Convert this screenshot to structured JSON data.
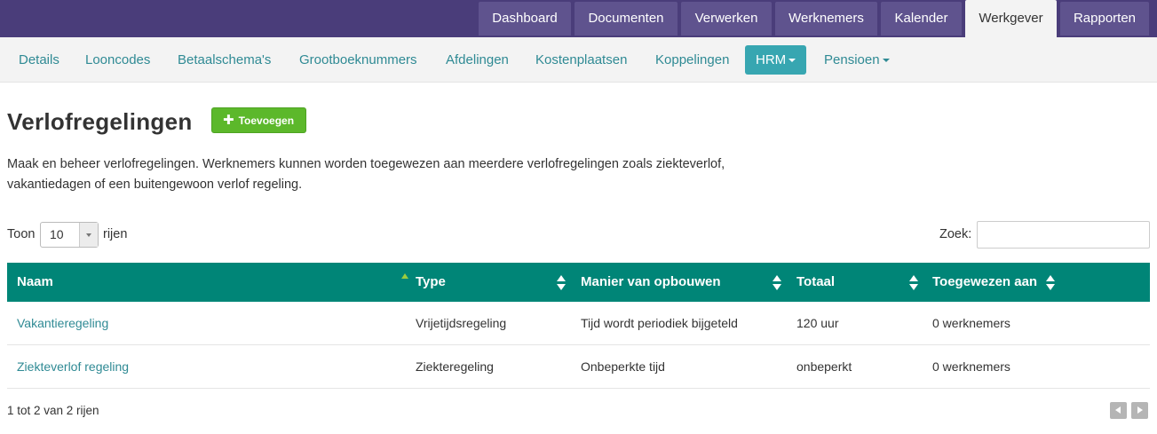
{
  "top_nav": [
    "Dashboard",
    "Documenten",
    "Verwerken",
    "Werknemers",
    "Kalender",
    "Werkgever",
    "Rapporten"
  ],
  "top_nav_active": "Werkgever",
  "sub_nav": [
    "Details",
    "Looncodes",
    "Betaalschema's",
    "Grootboeknummers",
    "Afdelingen",
    "Kostenplaatsen",
    "Koppelingen",
    "HRM",
    "Pensioen"
  ],
  "sub_nav_active": "HRM",
  "page": {
    "title": "Verlofregelingen",
    "add_button": "Toevoegen",
    "description": "Maak en beheer verlofregelingen. Werknemers kunnen worden toegewezen aan meerdere verlofregelingen zoals ziekteverlof, vakantiedagen of een buitengewoon verlof regeling."
  },
  "table_controls": {
    "show_label": "Toon",
    "page_size": "10",
    "rows_label": "rijen",
    "search_label": "Zoek:",
    "search_value": ""
  },
  "table": {
    "columns": [
      "Naam",
      "Type",
      "Manier van opbouwen",
      "Totaal",
      "Toegewezen aan"
    ],
    "rows": [
      [
        "Vakantieregeling",
        "Vrijetijdsregeling",
        "Tijd wordt periodiek bijgeteld",
        "120 uur",
        "0 werknemers"
      ],
      [
        "Ziekteverlof regeling",
        "Ziekteregeling",
        "Onbeperkte tijd",
        "onbeperkt",
        "0 werknemers"
      ]
    ],
    "info": "1 tot 2 van 2 rijen"
  },
  "colors": {
    "top_nav_bg": "#4a3d7a",
    "top_tab_bg": "#5f538e",
    "sub_nav_active_bg": "#37a6b1",
    "table_header_bg": "#008577",
    "add_button_bg": "#5cb82b",
    "link": "#2f8a94"
  },
  "icons": {
    "add": "plus-icon",
    "sort": "sort-both-icon",
    "sort_active": "sort-ascending-icon",
    "dropdown": "caret-down-icon",
    "prev": "previous-page-icon",
    "next": "next-page-icon"
  }
}
